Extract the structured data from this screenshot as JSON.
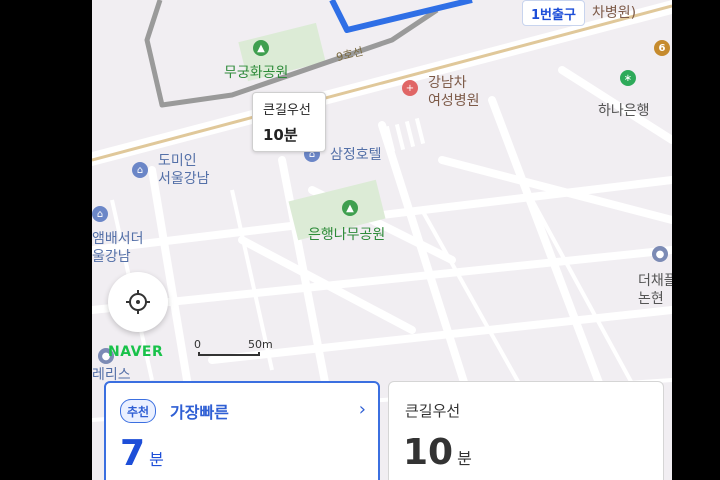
{
  "map": {
    "exit_badge": "1번출구",
    "hospital_top_right": "차병원)",
    "subway_line": "6",
    "road_name": "9호선",
    "labels": {
      "park1": "무궁화공원",
      "hospital1": "강남차\n여성병원",
      "bank": "하나은행",
      "hotel": "삼정호텔",
      "inn": "도미인\n서울강남",
      "park2": "은행나무공원",
      "ambassador": "앰배서더\n울강남",
      "right_poi": "더채플\n논현",
      "bottom_left": "레리스"
    },
    "tooltip": {
      "title": "큰길우선",
      "time": "10분"
    },
    "logo": "NAVER",
    "scale": {
      "zero": "0",
      "distance": "50m"
    }
  },
  "routes": [
    {
      "tag": "추천",
      "title": "가장빠른",
      "minutes": "7",
      "unit": "분"
    },
    {
      "title": "큰길우선",
      "minutes": "10",
      "unit": "분"
    }
  ],
  "colors": {
    "accent": "#1d4ed8",
    "park": "#2e8b3a",
    "hospital": "#e06666",
    "naver": "#19c24a"
  }
}
